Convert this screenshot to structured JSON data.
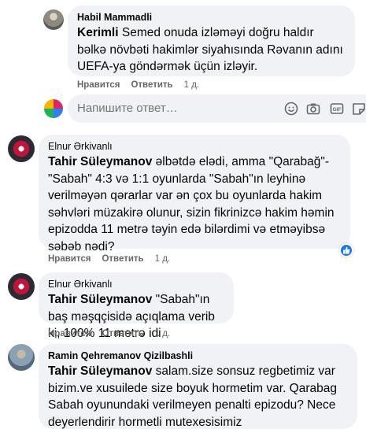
{
  "comments": [
    {
      "author": "Habil Mammadli",
      "mention": "Kerimli",
      "text": " Semed onuda izləməyi doğru haldır bəlkə növbəti hakimlər siyahısında Rəvanın adını UEFA-ya göndərmək üçün izləyir.",
      "like_label": "Нравится",
      "reply_label": "Ответить",
      "time": "1 д."
    },
    {
      "author": "Elnur Ərkivanlı",
      "mention": "Tahir Süleymanov",
      "text": " əlbətdə elədi, amma \"Qarabağ\"-\"Sabah\" 4:3 və 1:1 oyunlarda \"Sabah\"ın leyhinə verilməyən qərarlar var ən çox bu oyunlarda hakim səhvləri müzakirə olunur, sizin fikrinizcə hakim həmin epizodda 11 metrə təyin edə bilərdimi və etməyibsə səbəb nədi?",
      "like_label": "Нравится",
      "reply_label": "Ответить",
      "time": "1 д."
    },
    {
      "author": "Elnur Ərkivanlı",
      "mention": "Tahir Süleymanov",
      "text": " \"Sabah\"ın baş məşqçisidə açıqlama verib ki, 100% 11 metrə idi",
      "like_label": "Нравится",
      "reply_label": "Ответить",
      "time": "1 д."
    },
    {
      "author": "Ramin Qehremanov Qizilbashli",
      "mention": "Tahir Süleymanov",
      "text": " salam.size sonsuz regbetimiz var bizim.ve xusuilede size boyuk hormetim var. Qarabag Sabah oyunundaki verilmeyen penalti epizodu? Nece deyerlendirir hormetli mutexesisimiz"
    }
  ],
  "reply": {
    "placeholder": "Напишите ответ…"
  },
  "icons": {
    "emoji": "smiley-icon",
    "camera": "camera-icon",
    "gif": "gif-icon",
    "sticker": "sticker-icon",
    "like_badge": "thumbs-up-icon"
  },
  "colors": {
    "bubble": "#f0f2f5",
    "meta": "#65676b",
    "like_blue": "#1877f2"
  }
}
